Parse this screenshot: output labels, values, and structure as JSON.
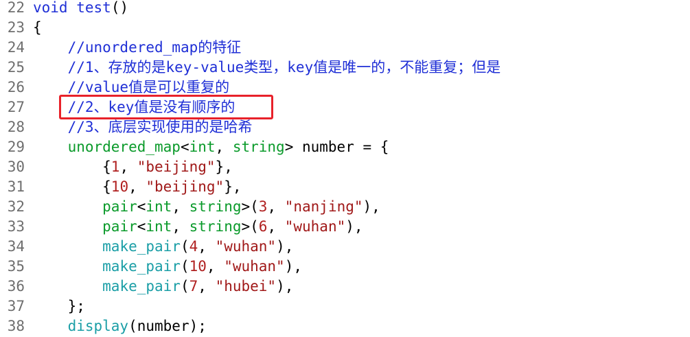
{
  "lines": [
    {
      "num": "22",
      "parts": [
        {
          "t": "void",
          "c": "kw"
        },
        {
          "t": " "
        },
        {
          "t": "test",
          "c": "fn"
        },
        {
          "t": "()"
        }
      ]
    },
    {
      "num": "23",
      "parts": [
        {
          "t": "{"
        }
      ]
    },
    {
      "num": "24",
      "parts": [
        {
          "t": "    "
        },
        {
          "t": "//unordered_map的特征",
          "c": "cm"
        }
      ]
    },
    {
      "num": "25",
      "parts": [
        {
          "t": "    "
        },
        {
          "t": "//1、存放的是key-value类型，key值是唯一的，不能重复；但是",
          "c": "cm"
        }
      ]
    },
    {
      "num": "26",
      "parts": [
        {
          "t": "    "
        },
        {
          "t": "//value值是可以重复的",
          "c": "cm"
        }
      ]
    },
    {
      "num": "27",
      "parts": [
        {
          "t": "    "
        },
        {
          "t": "//2、key值是没有顺序的",
          "c": "cm"
        }
      ]
    },
    {
      "num": "28",
      "parts": [
        {
          "t": "    "
        },
        {
          "t": "//3、底层实现使用的是哈希",
          "c": "cm"
        }
      ]
    },
    {
      "num": "29",
      "parts": [
        {
          "t": "    "
        },
        {
          "t": "unordered_map",
          "c": "gr"
        },
        {
          "t": "<"
        },
        {
          "t": "int",
          "c": "ty"
        },
        {
          "t": ", "
        },
        {
          "t": "string",
          "c": "ty"
        },
        {
          "t": "> number = {"
        }
      ]
    },
    {
      "num": "30",
      "parts": [
        {
          "t": "        {"
        },
        {
          "t": "1",
          "c": "num"
        },
        {
          "t": ", "
        },
        {
          "t": "\"beijing\"",
          "c": "str"
        },
        {
          "t": "},"
        }
      ]
    },
    {
      "num": "31",
      "parts": [
        {
          "t": "        {"
        },
        {
          "t": "10",
          "c": "num"
        },
        {
          "t": ", "
        },
        {
          "t": "\"beijing\"",
          "c": "str"
        },
        {
          "t": "},"
        }
      ]
    },
    {
      "num": "32",
      "parts": [
        {
          "t": "        "
        },
        {
          "t": "pair",
          "c": "gr"
        },
        {
          "t": "<"
        },
        {
          "t": "int",
          "c": "ty"
        },
        {
          "t": ", "
        },
        {
          "t": "string",
          "c": "ty"
        },
        {
          "t": ">("
        },
        {
          "t": "3",
          "c": "num"
        },
        {
          "t": ", "
        },
        {
          "t": "\"nanjing\"",
          "c": "str"
        },
        {
          "t": "),"
        }
      ]
    },
    {
      "num": "33",
      "parts": [
        {
          "t": "        "
        },
        {
          "t": "pair",
          "c": "gr"
        },
        {
          "t": "<"
        },
        {
          "t": "int",
          "c": "ty"
        },
        {
          "t": ", "
        },
        {
          "t": "string",
          "c": "ty"
        },
        {
          "t": ">("
        },
        {
          "t": "6",
          "c": "num"
        },
        {
          "t": ", "
        },
        {
          "t": "\"wuhan\"",
          "c": "str"
        },
        {
          "t": "),"
        }
      ]
    },
    {
      "num": "34",
      "parts": [
        {
          "t": "        "
        },
        {
          "t": "make_pair",
          "c": "cy"
        },
        {
          "t": "("
        },
        {
          "t": "4",
          "c": "num"
        },
        {
          "t": ", "
        },
        {
          "t": "\"wuhan\"",
          "c": "str"
        },
        {
          "t": "),"
        }
      ]
    },
    {
      "num": "35",
      "parts": [
        {
          "t": "        "
        },
        {
          "t": "make_pair",
          "c": "cy"
        },
        {
          "t": "("
        },
        {
          "t": "10",
          "c": "num"
        },
        {
          "t": ", "
        },
        {
          "t": "\"wuhan\"",
          "c": "str"
        },
        {
          "t": "),"
        }
      ]
    },
    {
      "num": "36",
      "parts": [
        {
          "t": "        "
        },
        {
          "t": "make_pair",
          "c": "cy"
        },
        {
          "t": "("
        },
        {
          "t": "7",
          "c": "num"
        },
        {
          "t": ", "
        },
        {
          "t": "\"hubei\"",
          "c": "str"
        },
        {
          "t": "),"
        }
      ]
    },
    {
      "num": "37",
      "parts": [
        {
          "t": "    };"
        }
      ]
    },
    {
      "num": "38",
      "parts": [
        {
          "t": "    "
        },
        {
          "t": "display",
          "c": "cy"
        },
        {
          "t": "(number);"
        }
      ]
    }
  ],
  "highlight": {
    "line": "27",
    "color": "#e8212a"
  },
  "colors": {
    "keyword": "#1f2fd6",
    "comment": "#1f2fd6",
    "type": "#0a9a2a",
    "function_call": "#1a9ea6",
    "number": "#b02020",
    "string": "#a01818",
    "line_number": "#6e6e6e"
  }
}
